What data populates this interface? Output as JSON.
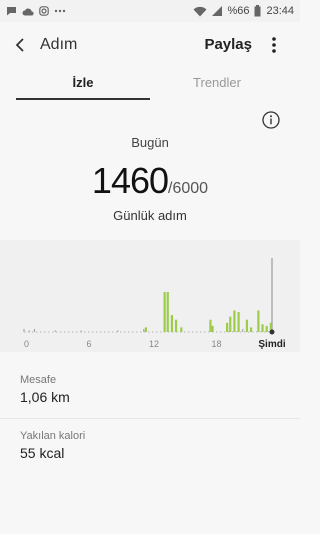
{
  "status_bar": {
    "battery_percent": "%66",
    "time": "23:44"
  },
  "header": {
    "title": "Adım",
    "share_label": "Paylaş"
  },
  "tabs": [
    {
      "label": "İzle",
      "active": true
    },
    {
      "label": "Trendler",
      "active": false
    }
  ],
  "summary": {
    "day_label": "Bugün",
    "steps": "1460",
    "goal": "/6000",
    "caption": "Günlük adım"
  },
  "chart_data": {
    "type": "bar",
    "xlabels": [
      "0",
      "6",
      "12",
      "18",
      "Şimdi"
    ],
    "x": [
      0,
      0.5,
      1,
      3,
      5.5,
      9,
      11.5,
      11.7,
      13.5,
      13.8,
      14.2,
      14.6,
      15.1,
      17.9,
      18.1,
      19.5,
      19.8,
      20.2,
      20.6,
      21.0,
      21.4,
      21.8,
      22.5,
      22.9,
      23.3,
      23.7
    ],
    "values": [
      2,
      1,
      2,
      1,
      1,
      1,
      2,
      3,
      26,
      26,
      11,
      8,
      3,
      8,
      4,
      6,
      10,
      14,
      13,
      2,
      8,
      3,
      14,
      5,
      4,
      6
    ],
    "colors": {
      "bar": "#9ccc4a",
      "baseline": "#b8b8b8",
      "marker": "#333333"
    }
  },
  "stats": [
    {
      "label": "Mesafe",
      "value": "1,06 km"
    },
    {
      "label": "Yakılan kalori",
      "value": "55 kcal"
    }
  ]
}
